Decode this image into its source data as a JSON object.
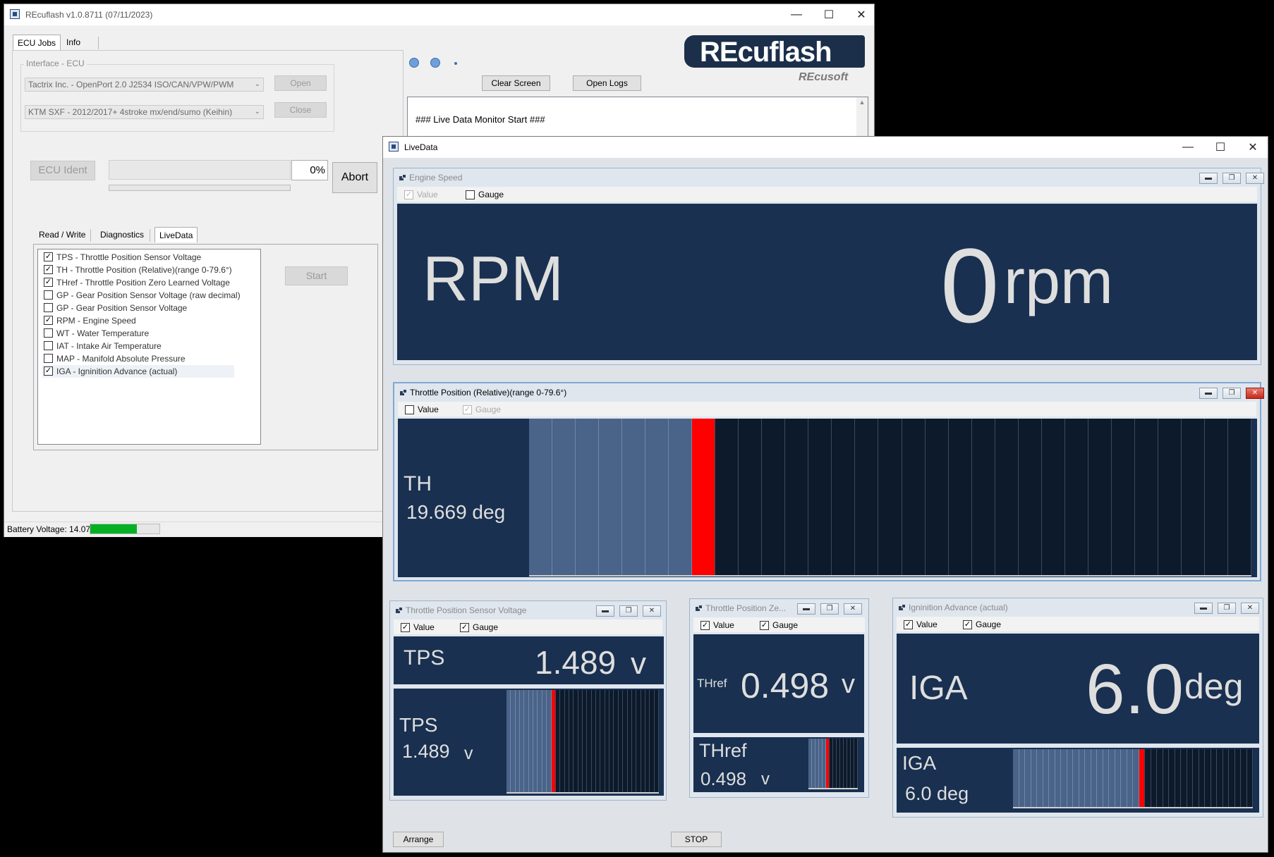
{
  "main_window": {
    "title": "REcuflash  v1.0.8711 (07/11/2023)",
    "tabs": [
      "ECU Jobs",
      "Info"
    ],
    "interface_group_label": "Interface - ECU",
    "interface_combo": "Tactrix Inc. - OpenPort 2.0 J2534 ISO/CAN/VPW/PWM",
    "ecu_combo": "KTM SXF - 2012/2017+ 4stroke mx/end/sumo (Keihin)",
    "open_button": "Open",
    "close_button": "Close",
    "ecu_ident_button": "ECU Ident",
    "percent": "0%",
    "abort_button": "Abort",
    "sub_tabs": [
      "Read / Write",
      "Diagnostics",
      "LiveData"
    ],
    "start_button": "Start",
    "clear_screen_button": "Clear Screen",
    "open_logs_button": "Open Logs",
    "log_text": "### Live Data Monitor Start ###",
    "logo_text": "REcuflash",
    "logo_sub": "REcusoft",
    "battery_label": "Battery Voltage: 14.07",
    "battery_level": 0.67,
    "param_list": [
      {
        "label": "TPS - Throttle Position Sensor Voltage",
        "checked": true
      },
      {
        "label": "TH - Throttle Position (Relative)(range 0-79.6°)",
        "checked": true
      },
      {
        "label": "THref - Throttle Position Zero Learned Voltage",
        "checked": true
      },
      {
        "label": "GP - Gear Position Sensor Voltage (raw decimal)",
        "checked": false
      },
      {
        "label": "GP - Gear Position Sensor Voltage",
        "checked": false
      },
      {
        "label": "RPM - Engine Speed",
        "checked": true
      },
      {
        "label": "WT - Water Temperature",
        "checked": false
      },
      {
        "label": "IAT - Intake Air Temperature",
        "checked": false
      },
      {
        "label": "MAP - Manifold Absolute Pressure",
        "checked": false
      },
      {
        "label": "IGA - Igninition Advance (actual)",
        "checked": true
      }
    ]
  },
  "live_window": {
    "title": "LiveData",
    "option_value": "Value",
    "option_gauge": "Gauge",
    "arrange_button": "Arrange",
    "stop_button": "STOP",
    "colors": {
      "panel": "#193050",
      "bar_fill": "#4a6388",
      "bar_empty": "#0d1a2b",
      "marker": "#ff0000"
    },
    "panels": {
      "engine_speed": {
        "title": "Engine Speed",
        "name": "RPM",
        "value": "0",
        "unit": "rpm"
      },
      "throttle": {
        "title": "Throttle Position (Relative)(range 0-79.6°)",
        "name": "TH",
        "value_unit": "19.669 deg",
        "bar_total": 31,
        "bar_filled": 7
      },
      "tps": {
        "title": "Throttle Position Sensor Voltage",
        "name": "TPS",
        "value": "1.489",
        "unit": "v",
        "bar_total": 34,
        "bar_filled": 10
      },
      "thref": {
        "title": "Throttle Position Ze...",
        "name": "THref",
        "value": "0.498",
        "unit": "v",
        "bar_total": 14,
        "bar_filled": 5
      },
      "iga": {
        "title": "Igninition Advance (actual)",
        "name": "IGA",
        "value": "6.0",
        "unit": "deg",
        "value_unit": "6.0 deg",
        "bar_total": 40,
        "bar_filled": 21
      }
    }
  }
}
